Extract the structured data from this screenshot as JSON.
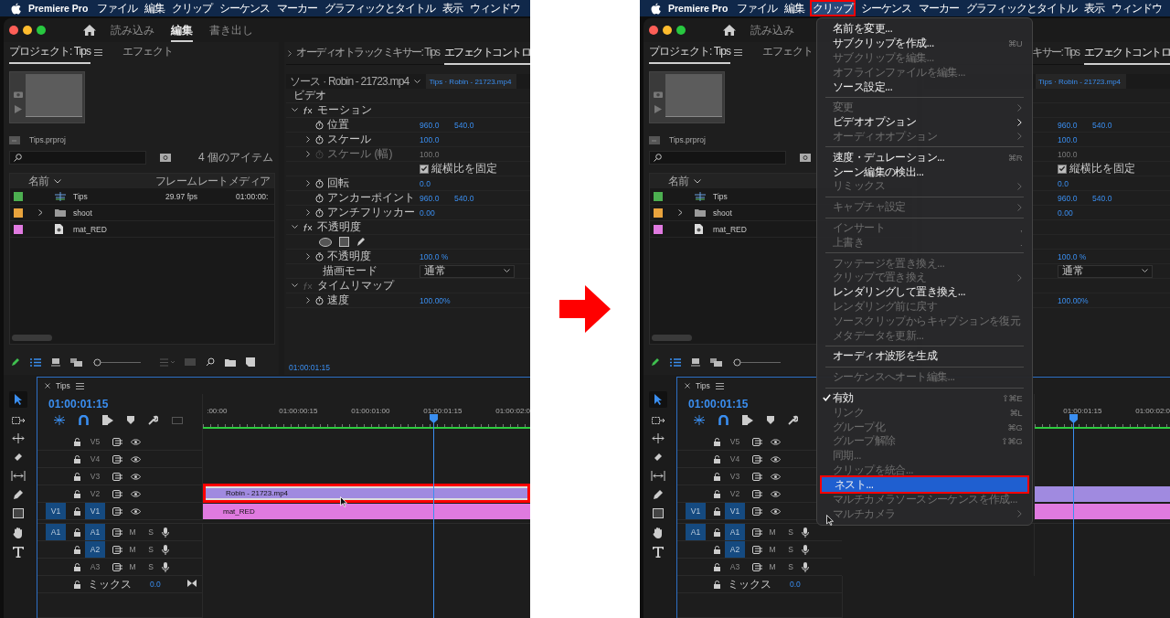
{
  "screens": [
    {
      "menubar": {
        "app": "Premiere Pro",
        "items": [
          {
            "label": "ファイル",
            "selected": false
          },
          {
            "label": "編集",
            "selected": false
          },
          {
            "label": "クリップ",
            "selected": false
          },
          {
            "label": "シーケンス",
            "selected": false
          },
          {
            "label": "マーカー",
            "selected": false
          },
          {
            "label": "グラフィックとタイトル",
            "selected": false
          },
          {
            "label": "表示",
            "selected": false
          },
          {
            "label": "ウィンドウ",
            "selected": false
          }
        ]
      },
      "workspaces": [
        {
          "label": "読み込み",
          "selected": false
        },
        {
          "label": "編集",
          "selected": true
        },
        {
          "label": "書き出し",
          "selected": false
        }
      ],
      "project": {
        "tabs": [
          {
            "label": "プロジェクト: Tips",
            "selected": true
          },
          {
            "label": "エフェクト",
            "selected": false
          }
        ],
        "file": "Tips.prproj",
        "item_count": "4 個のアイテム",
        "zoom": {
          "level": 0
        },
        "columns": [
          "名前",
          "フレームレート",
          "メディア"
        ],
        "rows": [
          {
            "kind": "sequence",
            "name": "Tips",
            "color": "#4caf50",
            "frame_rate": "29.97 fps",
            "media": "01:00:00:"
          },
          {
            "kind": "folder",
            "name": "shoot",
            "color": "#e8a33d"
          },
          {
            "kind": "matte",
            "name": "mat_RED",
            "color": "#e07ae0"
          }
        ]
      },
      "effects": {
        "tabs": [
          {
            "label": "オーディオトラックミキサー: Tips",
            "selected": false
          },
          {
            "label": "エフェクトコントロ",
            "selected": true
          }
        ],
        "source": "ソース · Robin - 21723.mp4",
        "target": "Tips · Robin - 21723.mp4",
        "timecode": "01:00:01:15",
        "rows": [
          {
            "kind": "header",
            "label": "ビデオ"
          },
          {
            "kind": "group",
            "label": "モーション",
            "expanded": true,
            "fx_on": true
          },
          {
            "kind": "prop",
            "label": "位置",
            "values": [
              "960.0",
              "540.0"
            ],
            "expandable": false,
            "disabled": false
          },
          {
            "kind": "prop",
            "label": "スケール",
            "values": [
              "100.0"
            ],
            "expandable": true,
            "disabled": false
          },
          {
            "kind": "prop",
            "label": "スケール (幅)",
            "values": [
              "100.0"
            ],
            "expandable": true,
            "disabled": true
          },
          {
            "kind": "checkbox",
            "label": "縦横比を固定",
            "checked": true
          },
          {
            "kind": "prop",
            "label": "回転",
            "values": [
              "0.0"
            ],
            "expandable": true,
            "disabled": false
          },
          {
            "kind": "prop",
            "label": "アンカーポイント",
            "values": [
              "960.0",
              "540.0"
            ],
            "expandable": false,
            "disabled": false
          },
          {
            "kind": "prop",
            "label": "アンチフリッカー",
            "values": [
              "0.00"
            ],
            "expandable": true,
            "disabled": false
          },
          {
            "kind": "group",
            "label": "不透明度",
            "expanded": true,
            "fx_on": true
          },
          {
            "kind": "masks"
          },
          {
            "kind": "prop",
            "label": "不透明度",
            "values": [
              "100.0 %"
            ],
            "expandable": true,
            "disabled": false
          },
          {
            "kind": "dropdown",
            "label": "描画モード",
            "value": "通常"
          },
          {
            "kind": "group",
            "label": "タイムリマップ",
            "expanded": true,
            "fx_on": false
          },
          {
            "kind": "prop",
            "label": "速度",
            "values": [
              "100.00%"
            ],
            "expandable": true,
            "disabled": false
          }
        ]
      },
      "timeline": {
        "title": "Tips",
        "timecode": "01:00:01:15",
        "ruler": [
          ":00:00",
          "01:00:00:15",
          "01:00:01:00",
          "01:00:01:15",
          "01:00:02:0"
        ],
        "tracks": [
          {
            "kind": "video",
            "name": "V5",
            "targeted": false
          },
          {
            "kind": "video",
            "name": "V4",
            "targeted": false
          },
          {
            "kind": "video",
            "name": "V3",
            "targeted": false
          },
          {
            "kind": "video",
            "name": "V2",
            "targeted": false,
            "clip": {
              "name": "Robin - 21723.mp4",
              "color": "#a08ae0",
              "selected": true
            }
          },
          {
            "kind": "video",
            "name": "V1",
            "targeted": true,
            "source": "V1",
            "clip": {
              "name": "mat_RED",
              "color": "#e07ae0",
              "selected": false
            }
          },
          {
            "kind": "audio",
            "name": "A1",
            "targeted": true,
            "source": "A1",
            "mute": "M",
            "solo": "S"
          },
          {
            "kind": "audio",
            "name": "A2",
            "targeted": true,
            "mute": "M",
            "solo": "S"
          },
          {
            "kind": "audio",
            "name": "A3",
            "targeted": false,
            "mute": "M",
            "solo": "S"
          }
        ],
        "mix": {
          "label": "ミックス",
          "value": "0.0"
        }
      }
    },
    {
      "menubar": {
        "app": "Premiere Pro",
        "items": [
          {
            "label": "ファイル",
            "selected": false
          },
          {
            "label": "編集",
            "selected": false
          },
          {
            "label": "クリップ",
            "selected": true
          },
          {
            "label": "シーケンス",
            "selected": false
          },
          {
            "label": "マーカー",
            "selected": false
          },
          {
            "label": "グラフィックとタイトル",
            "selected": false
          },
          {
            "label": "表示",
            "selected": false
          },
          {
            "label": "ウィンドウ",
            "selected": false
          }
        ]
      },
      "workspaces": [
        {
          "label": "読み込み",
          "selected": false
        }
      ],
      "project": {
        "tabs": [
          {
            "label": "プロジェクト: Tips",
            "selected": true
          },
          {
            "label": "エフェクト",
            "selected": false
          }
        ],
        "file": "Tips.prproj",
        "zoom": {
          "level": 0
        },
        "columns": [
          "名前"
        ],
        "rows": [
          {
            "kind": "sequence",
            "name": "Tips",
            "color": "#4caf50"
          },
          {
            "kind": "folder",
            "name": "shoot",
            "color": "#e8a33d"
          },
          {
            "kind": "matte",
            "name": "mat_RED",
            "color": "#e07ae0"
          }
        ]
      },
      "effects": {
        "tabs": [
          {
            "label": "キサー: Tips",
            "selected": false
          },
          {
            "label": "エフェクトコントロ",
            "selected": true
          }
        ],
        "target": "Tips · Robin - 21723.mp4",
        "rows": [
          {
            "kind": "header"
          },
          {
            "kind": "group"
          },
          {
            "kind": "prop",
            "values": [
              "960.0",
              "540.0"
            ],
            "disabled": false
          },
          {
            "kind": "prop",
            "values": [
              "100.0"
            ],
            "disabled": false
          },
          {
            "kind": "prop",
            "values": [
              "100.0"
            ],
            "disabled": true
          },
          {
            "kind": "checkbox",
            "label": "縦横比を固定",
            "checked": true
          },
          {
            "kind": "prop",
            "values": [
              "0.0"
            ],
            "disabled": false
          },
          {
            "kind": "prop",
            "values": [
              "960.0",
              "540.0"
            ],
            "disabled": false
          },
          {
            "kind": "prop",
            "values": [
              "0.00"
            ],
            "disabled": false
          },
          {
            "kind": "group"
          },
          {
            "kind": "masks"
          },
          {
            "kind": "prop",
            "values": [
              "100.0 %"
            ],
            "disabled": false
          },
          {
            "kind": "dropdown",
            "value": "通常"
          },
          {
            "kind": "group"
          },
          {
            "kind": "prop",
            "values": [
              "100.00%"
            ],
            "disabled": false
          }
        ]
      },
      "timeline": {
        "title": "Tips",
        "timecode": "01:00:01:15",
        "ruler": [
          "01:00:01:15",
          "01:00:02:0"
        ],
        "tracks": [
          {
            "kind": "video",
            "name": "V5",
            "targeted": false
          },
          {
            "kind": "video",
            "name": "V4",
            "targeted": false
          },
          {
            "kind": "video",
            "name": "V3",
            "targeted": false
          },
          {
            "kind": "video",
            "name": "V2",
            "targeted": false,
            "clip": {
              "color": "#a08ae0",
              "selected": false
            }
          },
          {
            "kind": "video",
            "name": "V1",
            "targeted": true,
            "source": "V1",
            "clip": {
              "color": "#e07ae0",
              "selected": false
            }
          },
          {
            "kind": "audio",
            "name": "A1",
            "targeted": true,
            "source": "A1",
            "mute": "M",
            "solo": "S"
          },
          {
            "kind": "audio",
            "name": "A2",
            "targeted": true,
            "mute": "M",
            "solo": "S"
          },
          {
            "kind": "audio",
            "name": "A3",
            "targeted": false,
            "mute": "M",
            "solo": "S"
          }
        ],
        "mix": {
          "label": "ミックス",
          "value": "0.0"
        }
      },
      "menu": {
        "items": [
          {
            "kind": "item",
            "label": "名前を変更...",
            "disabled": false,
            "checked": false,
            "selected": false
          },
          {
            "kind": "item",
            "label": "サブクリップを作成...",
            "shortcut": "⌘U",
            "disabled": false,
            "checked": false,
            "selected": false
          },
          {
            "kind": "item",
            "label": "サブクリップを編集...",
            "disabled": true,
            "checked": false,
            "selected": false
          },
          {
            "kind": "item",
            "label": "オフラインファイルを編集...",
            "disabled": true,
            "checked": false,
            "selected": false
          },
          {
            "kind": "item",
            "label": "ソース設定...",
            "disabled": false,
            "checked": false,
            "selected": false
          },
          {
            "kind": "separator"
          },
          {
            "kind": "submenu",
            "label": "変更",
            "disabled": true,
            "checked": false,
            "selected": false
          },
          {
            "kind": "submenu",
            "label": "ビデオオプション",
            "disabled": false,
            "checked": false,
            "selected": false
          },
          {
            "kind": "submenu",
            "label": "オーディオオプション",
            "disabled": true,
            "checked": false,
            "selected": false
          },
          {
            "kind": "separator"
          },
          {
            "kind": "item",
            "label": "速度・デュレーション...",
            "shortcut": "⌘R",
            "disabled": false,
            "checked": false,
            "selected": false
          },
          {
            "kind": "item",
            "label": "シーン編集の検出...",
            "disabled": false,
            "checked": false,
            "selected": false
          },
          {
            "kind": "submenu",
            "label": "リミックス",
            "disabled": true,
            "checked": false,
            "selected": false
          },
          {
            "kind": "separator"
          },
          {
            "kind": "submenu",
            "label": "キャプチャ設定",
            "disabled": true,
            "checked": false,
            "selected": false
          },
          {
            "kind": "separator"
          },
          {
            "kind": "item",
            "label": "インサート",
            "shortcut": ",",
            "disabled": true,
            "checked": false,
            "selected": false
          },
          {
            "kind": "item",
            "label": "上書き",
            "shortcut": ".",
            "disabled": true,
            "checked": false,
            "selected": false
          },
          {
            "kind": "separator"
          },
          {
            "kind": "item",
            "label": "フッテージを置き換え...",
            "disabled": true,
            "checked": false,
            "selected": false
          },
          {
            "kind": "submenu",
            "label": "クリップで置き換え",
            "disabled": true,
            "checked": false,
            "selected": false
          },
          {
            "kind": "item",
            "label": "レンダリングして置き換え...",
            "disabled": false,
            "checked": false,
            "selected": false
          },
          {
            "kind": "item",
            "label": "レンダリング前に戻す",
            "disabled": true,
            "checked": false,
            "selected": false
          },
          {
            "kind": "item",
            "label": "ソースクリップからキャプションを復元",
            "disabled": true,
            "checked": false,
            "selected": false
          },
          {
            "kind": "item",
            "label": "メタデータを更新...",
            "disabled": true,
            "checked": false,
            "selected": false
          },
          {
            "kind": "separator"
          },
          {
            "kind": "item",
            "label": "オーディオ波形を生成",
            "disabled": false,
            "checked": false,
            "selected": false
          },
          {
            "kind": "separator"
          },
          {
            "kind": "item",
            "label": "シーケンスへオート編集...",
            "disabled": true,
            "checked": false,
            "selected": false
          },
          {
            "kind": "separator"
          },
          {
            "kind": "item",
            "label": "有効",
            "shortcut": "⇧⌘E",
            "disabled": false,
            "checked": true,
            "selected": false
          },
          {
            "kind": "item",
            "label": "リンク",
            "shortcut": "⌘L",
            "disabled": true,
            "checked": false,
            "selected": false
          },
          {
            "kind": "item",
            "label": "グループ化",
            "shortcut": "⌘G",
            "disabled": true,
            "checked": false,
            "selected": false
          },
          {
            "kind": "item",
            "label": "グループ解除",
            "shortcut": "⇧⌘G",
            "disabled": true,
            "checked": false,
            "selected": false
          },
          {
            "kind": "item",
            "label": "同期...",
            "disabled": true,
            "checked": false,
            "selected": false
          },
          {
            "kind": "item",
            "label": "クリップを統合...",
            "disabled": true,
            "checked": false,
            "selected": false
          },
          {
            "kind": "item",
            "label": "ネスト...",
            "disabled": false,
            "checked": false,
            "selected": true
          },
          {
            "kind": "item",
            "label": "マルチカメラソースシーケンスを作成...",
            "disabled": true,
            "checked": false,
            "selected": false
          },
          {
            "kind": "submenu",
            "label": "マルチカメラ",
            "disabled": true,
            "checked": false,
            "selected": false
          }
        ]
      }
    }
  ]
}
